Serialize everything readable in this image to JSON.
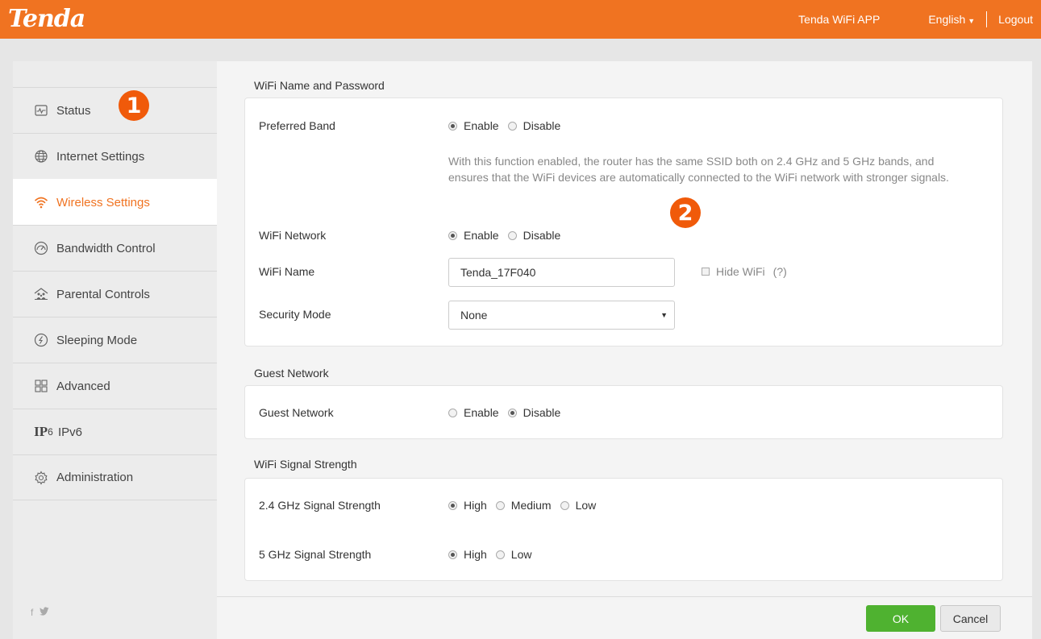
{
  "header": {
    "logo": "Tenda",
    "app_link": "Tenda WiFi APP",
    "language": "English",
    "logout": "Logout"
  },
  "sidebar": {
    "items": [
      {
        "label": "Status",
        "icon": "status-icon"
      },
      {
        "label": "Internet Settings",
        "icon": "globe-icon"
      },
      {
        "label": "Wireless Settings",
        "icon": "wifi-icon",
        "active": true
      },
      {
        "label": "Bandwidth Control",
        "icon": "gauge-icon"
      },
      {
        "label": "Parental Controls",
        "icon": "family-icon"
      },
      {
        "label": "Sleeping Mode",
        "icon": "sleep-icon"
      },
      {
        "label": "Advanced",
        "icon": "grid-icon"
      },
      {
        "label": "IPv6",
        "icon": "ipv6-icon"
      },
      {
        "label": "Administration",
        "icon": "gear-icon"
      }
    ],
    "ipv6_icon_text": "IP",
    "ipv6_icon_sub": "6",
    "social": [
      "f",
      "t"
    ]
  },
  "callouts": [
    "1",
    "2"
  ],
  "wifi_section": {
    "title": "WiFi Name and Password",
    "preferred_band": {
      "label": "Preferred Band",
      "options": [
        "Enable",
        "Disable"
      ],
      "selected": "Enable"
    },
    "description_line1": "With this function enabled, the router has the same SSID both on 2.4 GHz and 5 GHz bands, and",
    "description_line2": "ensures that the WiFi devices are automatically connected to the WiFi network with stronger signals.",
    "wifi_network": {
      "label": "WiFi Network",
      "options": [
        "Enable",
        "Disable"
      ],
      "selected": "Enable"
    },
    "wifi_name": {
      "label": "WiFi Name",
      "value": "Tenda_17F040",
      "hide_label": "Hide WiFi",
      "help": "(?)",
      "hide_checked": false
    },
    "security_mode": {
      "label": "Security Mode",
      "value": "None"
    }
  },
  "guest_section": {
    "title": "Guest Network",
    "guest_network": {
      "label": "Guest Network",
      "options": [
        "Enable",
        "Disable"
      ],
      "selected": "Disable"
    }
  },
  "signal_section": {
    "title": "WiFi Signal Strength",
    "band_24": {
      "label": "2.4 GHz Signal Strength",
      "options": [
        "High",
        "Medium",
        "Low"
      ],
      "selected": "High"
    },
    "band_5": {
      "label": "5 GHz Signal Strength",
      "options": [
        "High",
        "Low"
      ],
      "selected": "High"
    }
  },
  "footer": {
    "ok": "OK",
    "cancel": "Cancel"
  },
  "colors": {
    "brand": "#f07321",
    "ok_button": "#4fb230",
    "callout": "#f05a0a"
  }
}
